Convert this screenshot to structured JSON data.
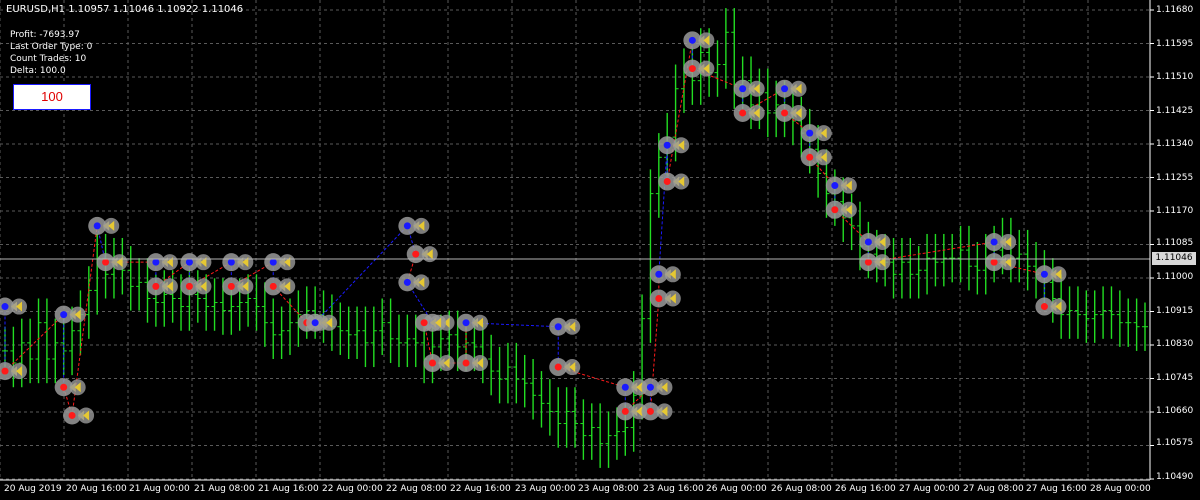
{
  "header": {
    "title": "EURUSD,H1  1.10957 1.11046 1.10922 1.11046"
  },
  "info": {
    "profit": "Profit: -7693.97",
    "last_order_type": "Last Order Type: 0",
    "count_trades": "Count Trades: 10",
    "delta": "Delta: 100.0"
  },
  "lot_input": {
    "value": "100"
  },
  "price_axis": {
    "labels": [
      "1.11680",
      "1.11595",
      "1.11510",
      "1.11425",
      "1.11340",
      "1.11255",
      "1.11170",
      "1.11085",
      "1.11000",
      "1.10915",
      "1.10830",
      "1.10745",
      "1.10660",
      "1.10575",
      "1.10490"
    ],
    "current_price": "1.11046"
  },
  "time_axis": {
    "labels": [
      "20 Aug 2019",
      "20 Aug 16:00",
      "21 Aug 00:00",
      "21 Aug 08:00",
      "21 Aug 16:00",
      "22 Aug 00:00",
      "22 Aug 08:00",
      "22 Aug 16:00",
      "23 Aug 00:00",
      "23 Aug 08:00",
      "23 Aug 16:00",
      "26 Aug 00:00",
      "26 Aug 08:00",
      "26 Aug 16:00",
      "27 Aug 00:00",
      "27 Aug 08:00",
      "27 Aug 16:00",
      "28 Aug 00:00"
    ]
  },
  "colors": {
    "background": "#000000",
    "grid": "#5a5a5a",
    "candle": "#22dd22",
    "buy_marker": "#1a1aff",
    "sell_marker": "#ff1a1a",
    "marker_halo": "#9a9a9a",
    "close_arrow": "#e6c832"
  },
  "chart_data": {
    "type": "line",
    "symbol": "EURUSD",
    "timeframe": "H1",
    "ylim": [
      1.1049,
      1.1168
    ],
    "current_price": 1.11046,
    "series": [
      {
        "values": [
          1.1081,
          1.1078,
          1.1083,
          1.1079,
          1.1088,
          1.1079,
          1.1083,
          1.1081,
          1.1086,
          1.109,
          1.1096,
          1.1104,
          1.11,
          1.1103,
          1.1101,
          1.1097,
          1.1098,
          1.1094,
          1.1093,
          1.1095,
          1.1094,
          1.1092,
          1.1095,
          1.1094,
          1.1092,
          1.1093,
          1.1091,
          1.1092,
          1.1093,
          1.1094,
          1.1092,
          1.1088,
          1.1085,
          1.1086,
          1.1088,
          1.109,
          1.1091,
          1.109,
          1.1089,
          1.1087,
          1.1086,
          1.1085,
          1.1086,
          1.1083,
          1.1086,
          1.1088,
          1.1084,
          1.1083,
          1.1084,
          1.1083,
          1.1079,
          1.1082,
          1.1084,
          1.1085,
          1.1082,
          1.1083,
          1.1082,
          1.1079,
          1.1076,
          1.1074,
          1.1077,
          1.1074,
          1.1073,
          1.107,
          1.1068,
          1.1066,
          1.1063,
          1.1066,
          1.1063,
          1.106,
          1.1062,
          1.1058,
          1.106,
          1.1061,
          1.1062,
          1.107,
          1.1089,
          1.112,
          1.1129,
          1.1134,
          1.1146,
          1.115,
          1.1148,
          1.1155,
          1.115,
          1.1152,
          1.116,
          1.1147,
          1.1148,
          1.1142,
          1.1145,
          1.114,
          1.1142,
          1.114,
          1.1138,
          1.1135,
          1.1131,
          1.1125,
          1.112,
          1.1118,
          1.1114,
          1.1112,
          1.1107,
          1.1105,
          1.1104,
          1.1103,
          1.11,
          1.1103,
          1.11,
          1.1101,
          1.1104,
          1.1103,
          1.1104,
          1.1104,
          1.1106,
          1.1102,
          1.1101,
          1.1104,
          1.1106,
          1.1108,
          1.1104,
          1.1105,
          1.1102,
          1.11,
          1.1098,
          1.1094,
          1.109,
          1.1091,
          1.109,
          1.1089,
          1.109,
          1.1091,
          1.109,
          1.1088,
          1.1088,
          1.1087,
          1.1087
        ]
      }
    ],
    "trade_markers": [
      {
        "price": 1.1092,
        "type": "buy",
        "bar": 0
      },
      {
        "price": 1.1076,
        "type": "sell",
        "bar": 0
      },
      {
        "price": 1.109,
        "type": "buy",
        "bar": 7
      },
      {
        "price": 1.1072,
        "type": "sell",
        "bar": 7
      },
      {
        "price": 1.1065,
        "type": "sell",
        "bar": 8
      },
      {
        "price": 1.1112,
        "type": "buy",
        "bar": 11
      },
      {
        "price": 1.1103,
        "type": "sell",
        "bar": 12
      },
      {
        "price": 1.1103,
        "type": "buy",
        "bar": 18
      },
      {
        "price": 1.1097,
        "type": "sell",
        "bar": 18
      },
      {
        "price": 1.1103,
        "type": "buy",
        "bar": 22
      },
      {
        "price": 1.1097,
        "type": "sell",
        "bar": 22
      },
      {
        "price": 1.1103,
        "type": "buy",
        "bar": 27
      },
      {
        "price": 1.1097,
        "type": "sell",
        "bar": 27
      },
      {
        "price": 1.1103,
        "type": "buy",
        "bar": 32
      },
      {
        "price": 1.1097,
        "type": "sell",
        "bar": 32
      },
      {
        "price": 1.1088,
        "type": "sell",
        "bar": 36
      },
      {
        "price": 1.1088,
        "type": "buy",
        "bar": 37
      },
      {
        "price": 1.1112,
        "type": "buy",
        "bar": 48
      },
      {
        "price": 1.1105,
        "type": "sell",
        "bar": 49
      },
      {
        "price": 1.1098,
        "type": "buy",
        "bar": 48
      },
      {
        "price": 1.1088,
        "type": "buy",
        "bar": 51
      },
      {
        "price": 1.1088,
        "type": "sell",
        "bar": 50
      },
      {
        "price": 1.1078,
        "type": "sell",
        "bar": 51
      },
      {
        "price": 1.1078,
        "type": "sell",
        "bar": 55
      },
      {
        "price": 1.1088,
        "type": "buy",
        "bar": 55
      },
      {
        "price": 1.1087,
        "type": "buy",
        "bar": 66
      },
      {
        "price": 1.1077,
        "type": "sell",
        "bar": 66
      },
      {
        "price": 1.1072,
        "type": "buy",
        "bar": 74
      },
      {
        "price": 1.1066,
        "type": "sell",
        "bar": 74
      },
      {
        "price": 1.1072,
        "type": "buy",
        "bar": 77
      },
      {
        "price": 1.1066,
        "type": "sell",
        "bar": 77
      },
      {
        "price": 1.1094,
        "type": "sell",
        "bar": 78
      },
      {
        "price": 1.11,
        "type": "buy",
        "bar": 78
      },
      {
        "price": 1.1132,
        "type": "buy",
        "bar": 79
      },
      {
        "price": 1.1123,
        "type": "sell",
        "bar": 79
      },
      {
        "price": 1.1158,
        "type": "buy",
        "bar": 82
      },
      {
        "price": 1.1151,
        "type": "sell",
        "bar": 82
      },
      {
        "price": 1.1146,
        "type": "buy",
        "bar": 88
      },
      {
        "price": 1.114,
        "type": "sell",
        "bar": 88
      },
      {
        "price": 1.1146,
        "type": "buy",
        "bar": 93
      },
      {
        "price": 1.114,
        "type": "sell",
        "bar": 93
      },
      {
        "price": 1.1135,
        "type": "buy",
        "bar": 96
      },
      {
        "price": 1.1129,
        "type": "sell",
        "bar": 96
      },
      {
        "price": 1.1122,
        "type": "buy",
        "bar": 99
      },
      {
        "price": 1.1116,
        "type": "sell",
        "bar": 99
      },
      {
        "price": 1.1108,
        "type": "buy",
        "bar": 103
      },
      {
        "price": 1.1103,
        "type": "sell",
        "bar": 103
      },
      {
        "price": 1.1108,
        "type": "buy",
        "bar": 118
      },
      {
        "price": 1.1103,
        "type": "sell",
        "bar": 118
      },
      {
        "price": 1.11,
        "type": "buy",
        "bar": 124
      },
      {
        "price": 1.1092,
        "type": "sell",
        "bar": 124
      }
    ]
  }
}
